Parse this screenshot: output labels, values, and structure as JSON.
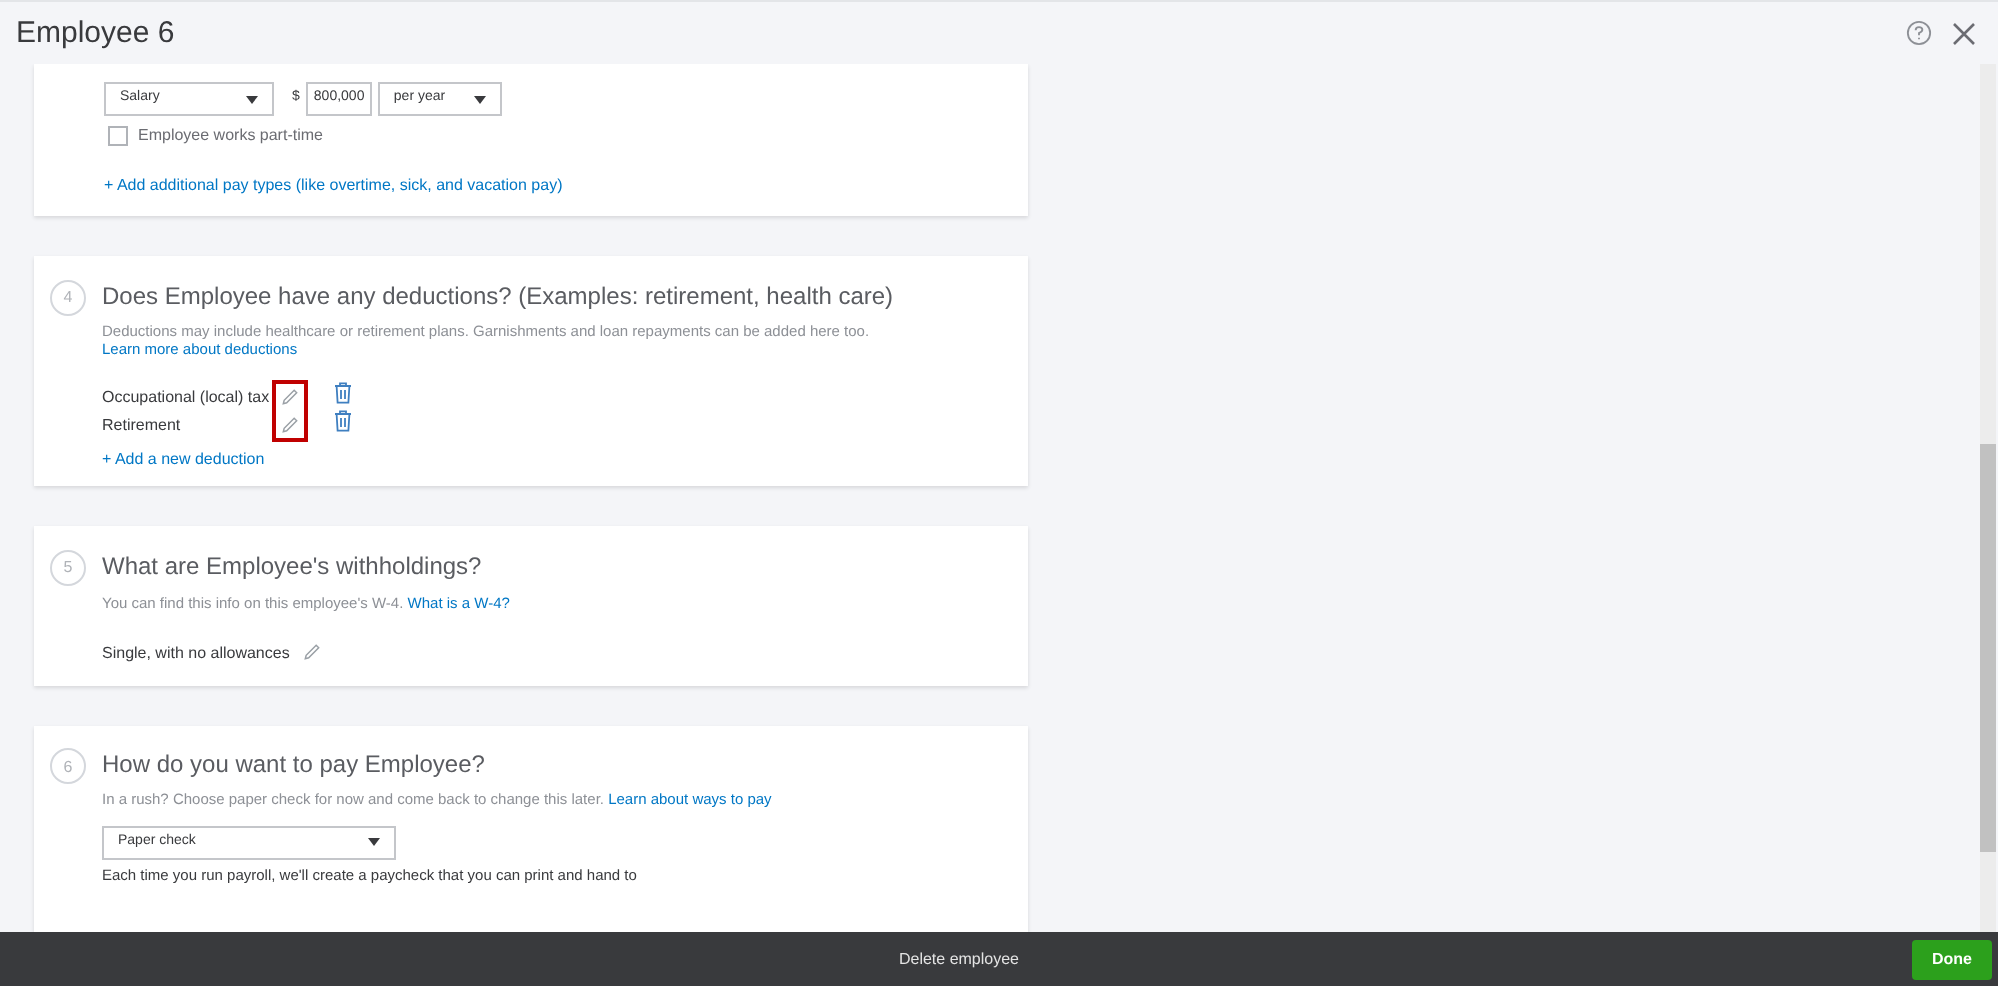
{
  "window": {
    "title": "Employee 6"
  },
  "pay": {
    "pay_type": "Salary",
    "currency": "$",
    "amount": "800,000",
    "period": "per year",
    "part_time": {
      "label": "Employee works part-time",
      "checked": false
    },
    "add_link": "+ Add additional pay types (like overtime, sick, and vacation pay)"
  },
  "deductions": {
    "step": "4",
    "title": "Does Employee have any deductions? (Examples: retirement, health care)",
    "description": "Deductions may include healthcare or retirement plans. Garnishments and loan repayments can be added here too.",
    "learn_link": "Learn more about deductions",
    "edit_highlighted": true,
    "items": [
      {
        "name": "Occupational (local) tax"
      },
      {
        "name": "Retirement"
      }
    ],
    "add_link": "+ Add a new deduction"
  },
  "withholdings": {
    "step": "5",
    "title": "What are Employee's withholdings?",
    "description": "You can find this info on this employee's W-4.",
    "link": "What is a W-4?",
    "value": "Single, with no allowances"
  },
  "payment": {
    "step": "6",
    "title": "How do you want to pay Employee?",
    "description": "In a rush? Choose paper check for now and come back to change this later.",
    "link": "Learn about ways to pay",
    "method": "Paper check",
    "note": "Each time you run payroll, we'll create a paycheck that you can print and hand to"
  },
  "footer": {
    "delete": "Delete employee",
    "done": "Done"
  }
}
